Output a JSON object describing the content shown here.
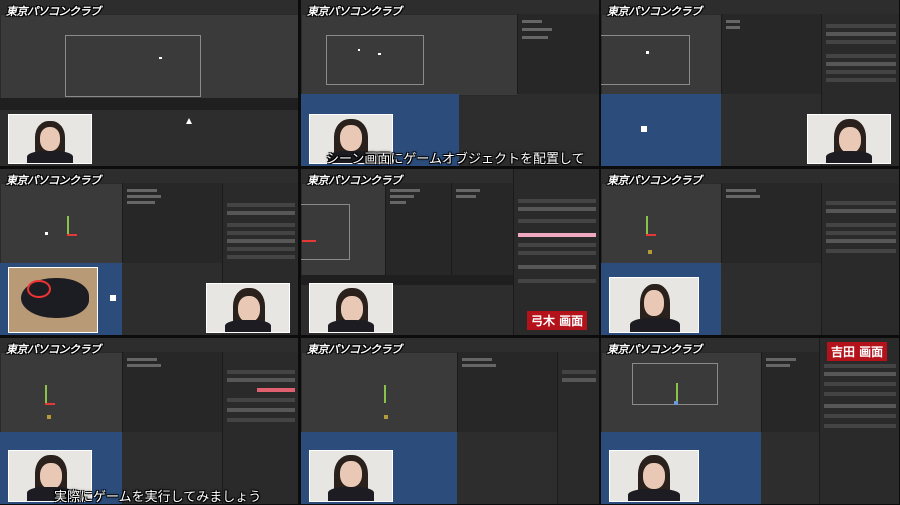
{
  "logo": "東京パソコンクラブ",
  "captions": {
    "top": "シーン画面にゲームオブジェクトを配置して",
    "bottom": "実際にゲームを実行してみましょう"
  },
  "badges": {
    "yumiki": "弓木 画面",
    "yoshida": "吉田 画面"
  },
  "colors": {
    "scene_blue": "#2c4d7c",
    "badge_red": "#b3121b",
    "editor_dark": "#2d2d2d"
  },
  "icons": [
    "mouse-photo",
    "gizmo-arrow",
    "camera-object",
    "cursor"
  ]
}
